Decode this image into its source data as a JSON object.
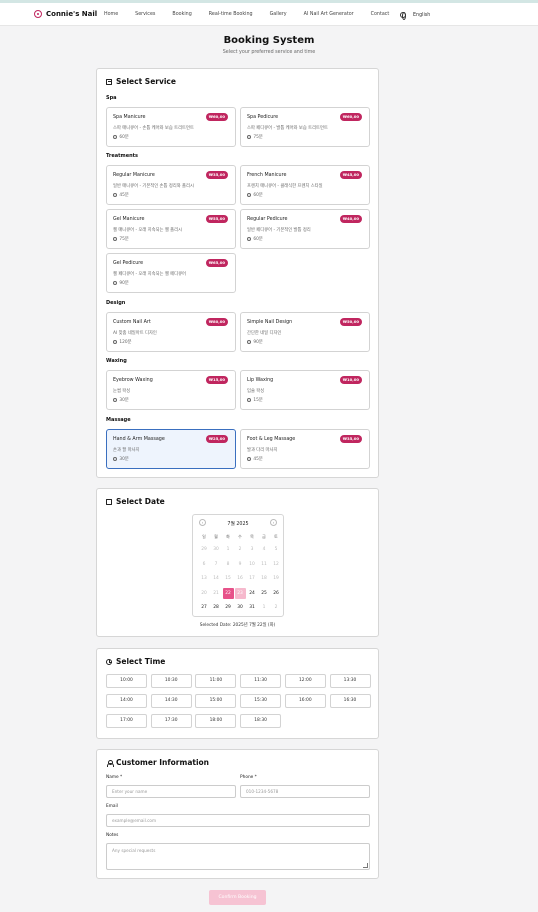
{
  "nav": {
    "brand": "Connie's Nail",
    "links": [
      "Home",
      "Services",
      "Booking",
      "Real-time Booking",
      "Gallery",
      "AI Nail Art Generator",
      "Contact"
    ],
    "language": "English"
  },
  "page": {
    "title": "Booking System",
    "subtitle": "Select your preferred service and time"
  },
  "services": {
    "heading": "Select Service",
    "categories": [
      "Spa",
      "Treatments",
      "Design",
      "Waxing",
      "Massage"
    ],
    "items": [
      {
        "name": "Spa Manicure",
        "desc": "스파 매니큐어 - 손톱 케어와 보습 트리트먼트",
        "duration": "60분",
        "price": "₩60,00"
      },
      {
        "name": "Spa Pedicure",
        "desc": "스파 페디큐어 - 발톱 케어와 보습 트리트먼트",
        "duration": "75분",
        "price": "₩60,00"
      },
      {
        "name": "Regular Manicure",
        "desc": "일반 매니큐어 - 기본적인 손톱 정리와 폴리시",
        "duration": "45분",
        "price": "₩35,00"
      },
      {
        "name": "French Manicure",
        "desc": "프렌치 매니큐어 - 클래식한 프렌치 스타일",
        "duration": "60분",
        "price": "₩45,00"
      },
      {
        "name": "Gel Manicure",
        "desc": "젤 매니큐어 - 오래 지속되는 젤 폴리시",
        "duration": "75분",
        "price": "₩55,00"
      },
      {
        "name": "Regular Pedicure",
        "desc": "일반 페디큐어 - 기본적인 발톱 정리",
        "duration": "60분",
        "price": "₩40,00"
      },
      {
        "name": "Gel Pedicure",
        "desc": "젤 페디큐어 - 오래 지속되는 젤 페디큐어",
        "duration": "90분",
        "price": "₩65,00"
      },
      {
        "name": "Custom Nail Art",
        "desc": "AI 맞춤 네일아트 디자인",
        "duration": "120분",
        "price": "₩80,00"
      },
      {
        "name": "Simple Nail Design",
        "desc": "간단한 네일 디자인",
        "duration": "90분",
        "price": "₩50,00"
      },
      {
        "name": "Eyebrow Waxing",
        "desc": "눈썹 왁싱",
        "duration": "30분",
        "price": "₩15,00"
      },
      {
        "name": "Lip Waxing",
        "desc": "입술 왁싱",
        "duration": "15분",
        "price": "₩10,00"
      },
      {
        "name": "Hand & Arm Massage",
        "desc": "손과 팔 마사지",
        "duration": "30분",
        "price": "₩25,00"
      },
      {
        "name": "Foot & Leg Massage",
        "desc": "발과 다리 마사지",
        "duration": "45분",
        "price": "₩35,00"
      }
    ]
  },
  "date": {
    "heading": "Select Date",
    "month_label": "7월 2025",
    "prev": "‹",
    "next": "›",
    "weekdays": [
      "일",
      "월",
      "화",
      "수",
      "목",
      "금",
      "토"
    ],
    "days": [
      "29",
      "30",
      "1",
      "2",
      "3",
      "4",
      "5",
      "6",
      "7",
      "8",
      "9",
      "10",
      "11",
      "12",
      "13",
      "14",
      "15",
      "16",
      "17",
      "18",
      "19",
      "20",
      "21",
      "22",
      "23",
      "24",
      "25",
      "26",
      "27",
      "28",
      "29",
      "30",
      "31",
      "1",
      "2"
    ],
    "selected_text": "Selected Date: 2025년 7월 22일 (화)"
  },
  "time": {
    "heading": "Select Time",
    "slots": [
      "10:00",
      "10:30",
      "11:00",
      "11:30",
      "12:00",
      "13:30",
      "14:00",
      "14:30",
      "15:00",
      "15:30",
      "16:00",
      "16:30",
      "17:00",
      "17:30",
      "18:00",
      "18:30"
    ]
  },
  "customer": {
    "heading": "Customer Information",
    "name_label": "Name *",
    "name_placeholder": "Enter your name",
    "phone_label": "Phone *",
    "phone_placeholder": "010-1234-5678",
    "email_label": "Email",
    "email_placeholder": "example@email.com",
    "notes_label": "Notes",
    "notes_placeholder": "Any special requests"
  },
  "submit_label": "Confirm Booking",
  "colors": {
    "accent": "#c0265f",
    "selected_day": "#e7528a",
    "selected_border": "#3a6fbf",
    "submit_disabled": "#f6c3d3"
  }
}
